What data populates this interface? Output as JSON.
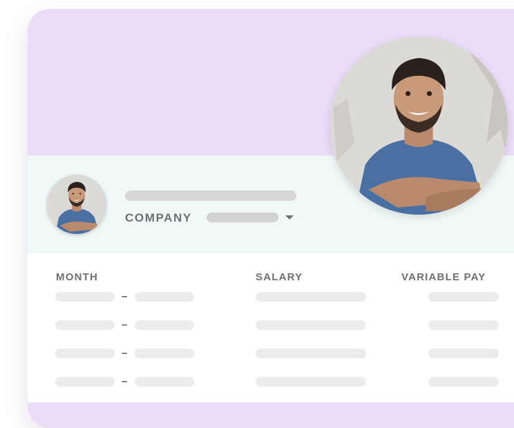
{
  "profile": {
    "company_label": "COMPANY",
    "avatar_icon": "person-photo-icon",
    "dropdown_icon": "chevron-down-icon"
  },
  "table": {
    "headers": [
      "MONTH",
      "SALARY",
      "VARIABLE PAY"
    ],
    "range_separator": "–",
    "row_count_visible": 4
  },
  "colors": {
    "hero_bg": "#ebdcf9",
    "profile_band_bg": "#f1f8f8",
    "header_text": "#6f6f72",
    "skeleton": "#ececee"
  }
}
